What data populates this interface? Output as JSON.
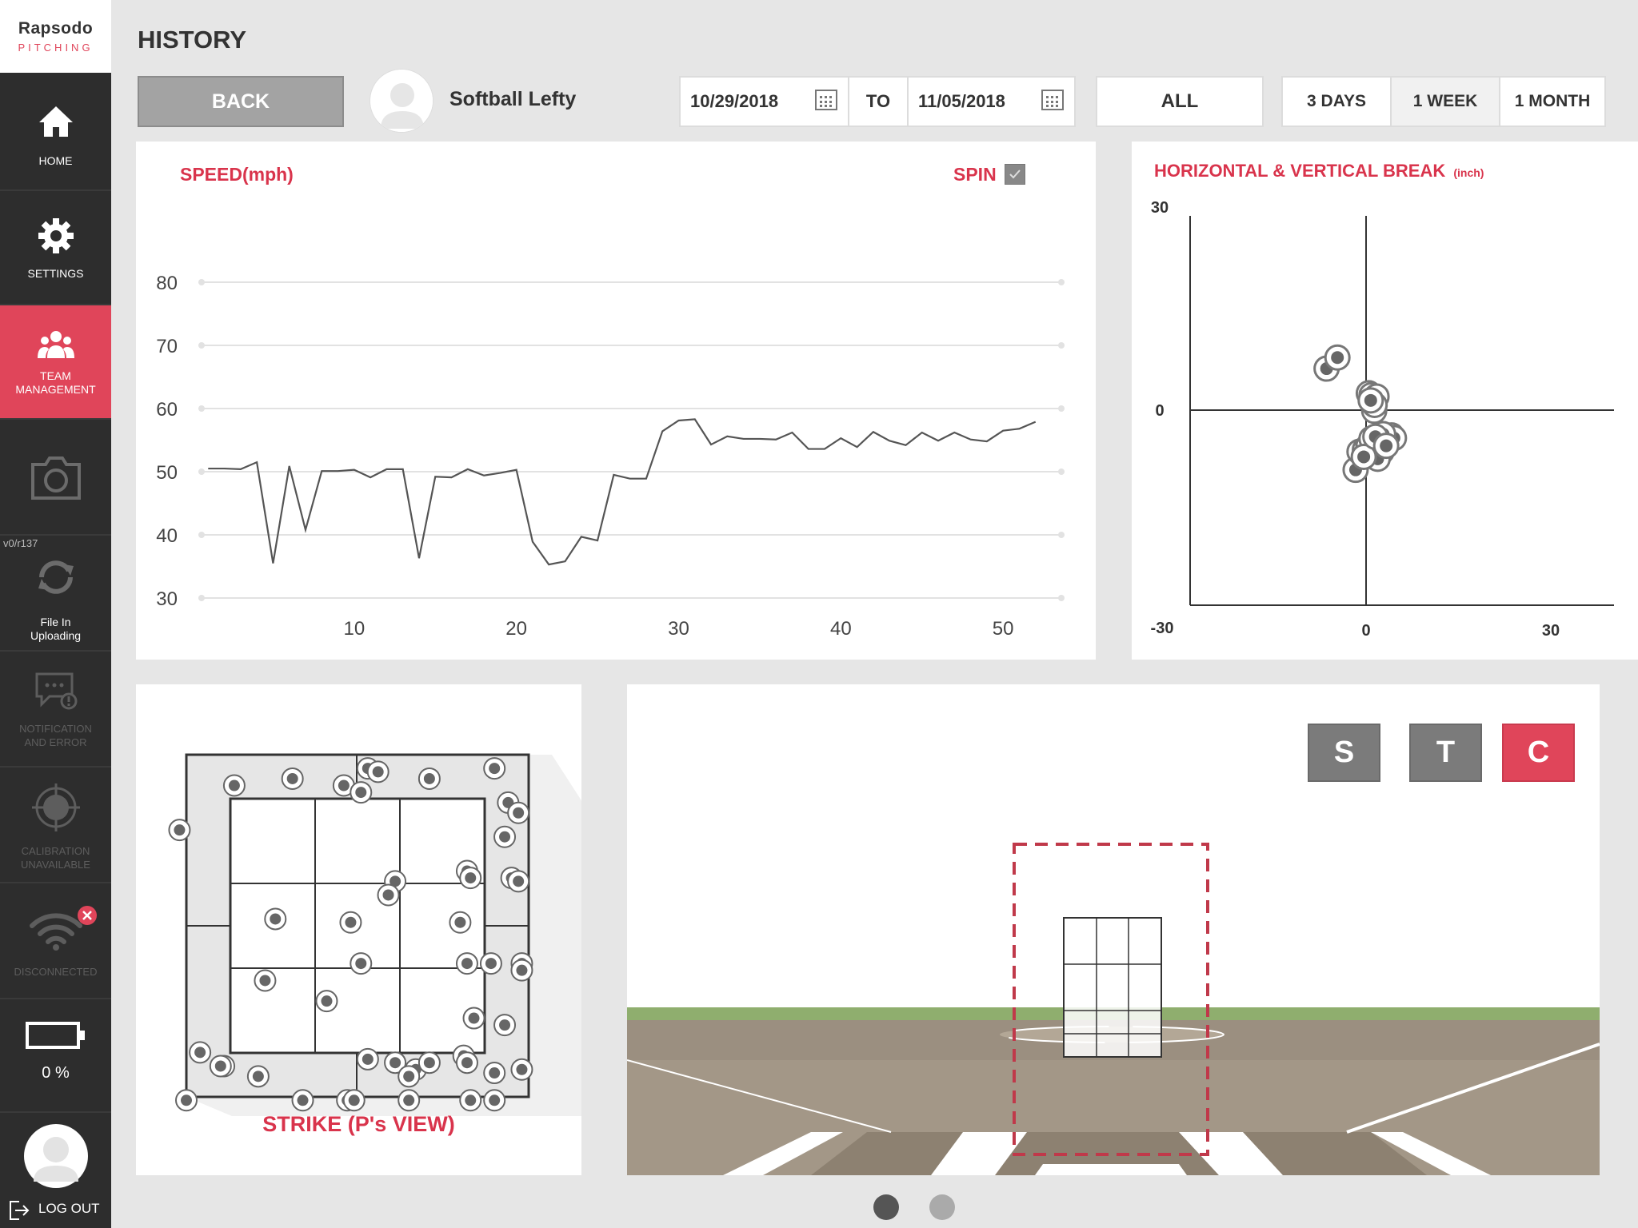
{
  "app": {
    "brand": "Rapsodo",
    "product": "PITCHING"
  },
  "sidebar": {
    "items": [
      {
        "label": "HOME"
      },
      {
        "label": "SETTINGS"
      },
      {
        "label": "TEAM\nMANAGEMENT"
      },
      {
        "label": ""
      },
      {
        "label": "File In\nUploading"
      },
      {
        "label": "NOTIFICATION\nAND ERROR"
      },
      {
        "label": "CALIBRATION\nUNAVAILABLE"
      },
      {
        "label": "DISCONNECTED"
      },
      {
        "label": "0 %"
      }
    ],
    "version": "v0/r137",
    "logout_label": "LOG OUT"
  },
  "header": {
    "title": "HISTORY",
    "back_label": "BACK",
    "player_name": "Softball Lefty",
    "date_from": "10/29/2018",
    "to_label": "TO",
    "date_to": "11/05/2018",
    "filter_all": "ALL",
    "ranges": [
      "3 DAYS",
      "1 WEEK",
      "1 MONTH"
    ],
    "selected_range": "1 WEEK"
  },
  "speed_panel": {
    "title": "SPEED(mph)",
    "spin_label": "SPIN",
    "spin_checked": true
  },
  "break_panel": {
    "title": "HORIZONTAL & VERTICAL BREAK",
    "unit": "(inch)"
  },
  "strike_panel": {
    "caption": "STRIKE (P's VIEW)"
  },
  "view_buttons": [
    "S",
    "T",
    "C"
  ],
  "active_view": "C",
  "pager": {
    "pages": 2,
    "current": 1
  },
  "colors": {
    "accent": "#e0455a",
    "sidebar": "#2d2d2d",
    "line": "#555555",
    "button_gray": "#7b7b7b"
  },
  "chart_data": [
    {
      "type": "line",
      "title": "SPEED(mph)",
      "x_ticks": [
        10,
        20,
        30,
        40,
        50
      ],
      "y_ticks": [
        30,
        40,
        50,
        60,
        70,
        80
      ],
      "ylim": [
        30,
        80
      ],
      "xlim": [
        0,
        53
      ],
      "grid": true,
      "x": [
        1,
        2,
        3,
        4,
        5,
        6,
        7,
        8,
        9,
        10,
        11,
        12,
        13,
        14,
        15,
        16,
        17,
        18,
        19,
        20,
        21,
        22,
        23,
        24,
        25,
        26,
        27,
        28,
        29,
        30,
        31,
        32,
        33,
        34,
        35,
        36,
        37,
        38,
        39,
        40,
        41,
        42,
        43,
        44,
        45,
        46,
        47,
        48,
        49,
        50,
        51,
        52
      ],
      "y": [
        50.5,
        50.5,
        50.4,
        51.5,
        35.5,
        50.9,
        40.8,
        50.1,
        50.1,
        50.3,
        49.1,
        50.4,
        50.4,
        36.3,
        49.2,
        49.1,
        50.4,
        49.4,
        49.8,
        50.3,
        38.9,
        35.3,
        35.8,
        39.7,
        39.1,
        49.5,
        48.9,
        48.9,
        56.4,
        58.1,
        58.3,
        54.3,
        55.6,
        55.2,
        55.2,
        55.1,
        56.2,
        53.6,
        53.6,
        55.3,
        53.9,
        56.3,
        54.9,
        54.2,
        56.2,
        54.9,
        56.2,
        55.1,
        54.8,
        56.5,
        56.8,
        57.9
      ]
    },
    {
      "type": "scatter",
      "title": "HORIZONTAL & VERTICAL BREAK (inch)",
      "xlim": [
        -30,
        30
      ],
      "ylim": [
        -30,
        30
      ],
      "x_ticks": [
        -30,
        0,
        30
      ],
      "y_ticks": [
        -30,
        0,
        30
      ],
      "points": [
        [
          -10.2,
          6.4
        ],
        [
          -7.4,
          8.1
        ],
        [
          0.7,
          2.6
        ],
        [
          1.8,
          1.4
        ],
        [
          2.1,
          -0.1
        ],
        [
          1.4,
          2.3
        ],
        [
          2.7,
          2.1
        ],
        [
          2.2,
          0.8
        ],
        [
          1.2,
          1.5
        ],
        [
          -2.7,
          -9.2
        ],
        [
          -1.7,
          -6.4
        ],
        [
          -0.3,
          -6.1
        ],
        [
          0.6,
          -5.5
        ],
        [
          1.4,
          -6.8
        ],
        [
          2.0,
          -5.9
        ],
        [
          3.3,
          -4.8
        ],
        [
          4.0,
          -6.4
        ],
        [
          4.8,
          -4.6
        ],
        [
          5.8,
          -4.8
        ],
        [
          6.6,
          -3.9
        ],
        [
          7.2,
          -4.3
        ],
        [
          3.0,
          -7.5
        ],
        [
          1.4,
          -4.4
        ],
        [
          -0.6,
          -7.2
        ],
        [
          4.4,
          -3.7
        ],
        [
          2.4,
          -4.1
        ],
        [
          5.2,
          -5.5
        ]
      ]
    },
    {
      "type": "scatter",
      "title": "STRIKE (P's VIEW)",
      "description": "pitch locations on 3x3 strike zone with ball zone border",
      "points": [
        [
          0.14,
          0.09
        ],
        [
          0.31,
          0.07
        ],
        [
          0.46,
          0.09
        ],
        [
          0.53,
          0.04
        ],
        [
          0.56,
          0.05
        ],
        [
          0.51,
          0.11
        ],
        [
          0.71,
          0.07
        ],
        [
          0.9,
          0.04
        ],
        [
          0.94,
          0.14
        ],
        [
          0.97,
          0.17
        ],
        [
          0.93,
          0.24
        ],
        [
          -0.02,
          0.22
        ],
        [
          0.82,
          0.34
        ],
        [
          0.83,
          0.36
        ],
        [
          0.61,
          0.37
        ],
        [
          0.59,
          0.41
        ],
        [
          0.26,
          0.48
        ],
        [
          0.48,
          0.49
        ],
        [
          0.8,
          0.49
        ],
        [
          0.51,
          0.61
        ],
        [
          0.82,
          0.61
        ],
        [
          0.89,
          0.61
        ],
        [
          0.98,
          0.61
        ],
        [
          0.98,
          0.63
        ],
        [
          0.95,
          0.36
        ],
        [
          0.97,
          0.37
        ],
        [
          0.23,
          0.66
        ],
        [
          0.41,
          0.72
        ],
        [
          0.84,
          0.77
        ],
        [
          0.93,
          0.79
        ],
        [
          0.04,
          0.87
        ],
        [
          0.11,
          0.91
        ],
        [
          0.1,
          0.91
        ],
        [
          0.21,
          0.94
        ],
        [
          0.53,
          0.89
        ],
        [
          0.61,
          0.9
        ],
        [
          0.67,
          0.92
        ],
        [
          0.71,
          0.9
        ],
        [
          0.65,
          0.94
        ],
        [
          0.81,
          0.88
        ],
        [
          0.82,
          0.9
        ],
        [
          0.9,
          0.93
        ],
        [
          0.98,
          0.92
        ],
        [
          0.0,
          1.01
        ],
        [
          0.34,
          1.01
        ],
        [
          0.47,
          1.01
        ],
        [
          0.49,
          1.01
        ],
        [
          0.65,
          1.01
        ],
        [
          0.83,
          1.01
        ],
        [
          0.9,
          1.01
        ]
      ]
    }
  ]
}
